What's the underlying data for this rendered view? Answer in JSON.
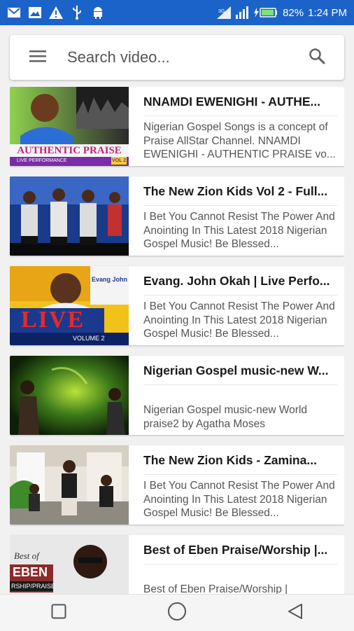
{
  "status_bar": {
    "battery": "82%",
    "time": "1:24 PM",
    "left_icons": [
      "email-icon",
      "image-icon",
      "warning-icon",
      "usb-icon",
      "android-icon"
    ],
    "right_icons": [
      "signal-icon",
      "signal-icon",
      "battery-charging-icon"
    ],
    "color": "#1b63c9"
  },
  "search": {
    "placeholder": "Search video...",
    "menu_icon": "menu-icon",
    "search_icon": "search-icon"
  },
  "videos": [
    {
      "title": "NNAMDI EWENIGHI - AUTHE...",
      "description": "Nigerian Gospel Songs is a concept of Praise AllStar Channel. NNAMDI EWENIGHI - AUTHENTIC PRAISE vo...",
      "thumbnail": {
        "banner_text": "AUTHENTIC PRAISE",
        "sub_text": "LIVE PERFORMANCE",
        "vol": "VOL 2"
      }
    },
    {
      "title": "The New Zion Kids Vol 2 - Full...",
      "description": "I Bet You Cannot Resist The Power And Anointing In This Latest 2018 Nigerian Gospel Music! Be Blessed...",
      "thumbnail": {}
    },
    {
      "title": "Evang. John Okah | Live Perfo...",
      "description": "I Bet You Cannot Resist The Power And Anointing In This Latest 2018 Nigerian Gospel Music! Be Blessed...",
      "thumbnail": {
        "banner_text": "LIVE",
        "name_text": "Evang John Oka",
        "sub_text": "VOLUME 2"
      }
    },
    {
      "title": "Nigerian Gospel music-new W...",
      "description": "Nigerian Gospel music-new World praise2 by Agatha Moses",
      "thumbnail": {}
    },
    {
      "title": "The New Zion Kids - Zamina...",
      "description": "I Bet You Cannot Resist The Power And Anointing In This Latest 2018 Nigerian Gospel Music! Be Blessed...",
      "thumbnail": {}
    },
    {
      "title": "Best of Eben Praise/Worship |...",
      "description": "Best of Eben Praise/Worship |",
      "thumbnail": {
        "best_of": "Best of",
        "name_text": "EBEN",
        "sub_text": "RSHIP/PRAISE"
      }
    }
  ],
  "nav": {
    "recents_icon": "square-recents-icon",
    "home_icon": "circle-home-icon",
    "back_icon": "triangle-back-icon"
  }
}
